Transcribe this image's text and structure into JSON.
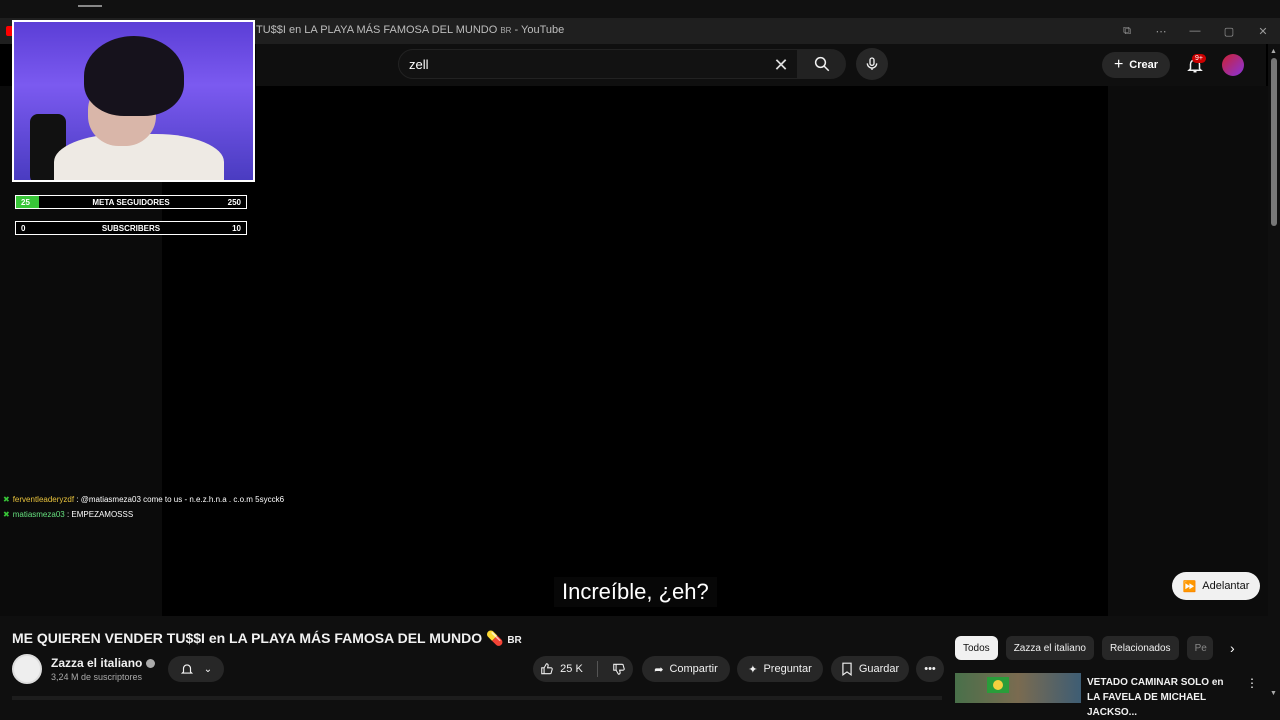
{
  "window": {
    "title": "TU$$I en LA PLAYA MÁS FAMOSA DEL MUNDO",
    "title_tag": "BR",
    "title_suffix": " - YouTube",
    "controls": [
      "⧉",
      "⋯",
      "—",
      "▢",
      "✕"
    ]
  },
  "masthead": {
    "search_value": "zell",
    "create_label": "Crear",
    "notifications_badge": "9+"
  },
  "overlay": {
    "follower_bar": {
      "left": "25",
      "label": "META SEGUIDORES",
      "right": "250",
      "progress": 0.1
    },
    "subscriber_bar": {
      "left": "0",
      "label": "SUBSCRIBERS",
      "right": "10"
    },
    "chat": [
      {
        "user": "ferventleaderyzdf",
        "message": " : @matiasmeza03 come to us - n.e.z.h.n.a . c.o.m 5sycck6"
      },
      {
        "user": "matiasmeza03",
        "message": " : EMPEZAMOSSS"
      }
    ]
  },
  "player": {
    "subtitle": "Increíble, ¿eh?",
    "skip_label": "Adelantar"
  },
  "video": {
    "title": "ME QUIEREN VENDER TU$$I en LA PLAYA MÁS FAMOSA DEL MUNDO",
    "title_tag": "BR",
    "channel": "Zazza el italiano",
    "subscribers": "3,24 M de suscriptores",
    "likes": "25 K",
    "share_label": "Compartir",
    "ask_label": "Preguntar",
    "save_label": "Guardar"
  },
  "chips": [
    "Todos",
    "Zazza el italiano",
    "Relacionados",
    "Pe"
  ],
  "recommendation": {
    "title": "VETADO CAMINAR SOLO en LA FAVELA DE MICHAEL JACKSO..."
  },
  "colors": {
    "accent_red": "#ff0000",
    "progress_green": "#38c538",
    "badge_red": "#cc0000"
  }
}
